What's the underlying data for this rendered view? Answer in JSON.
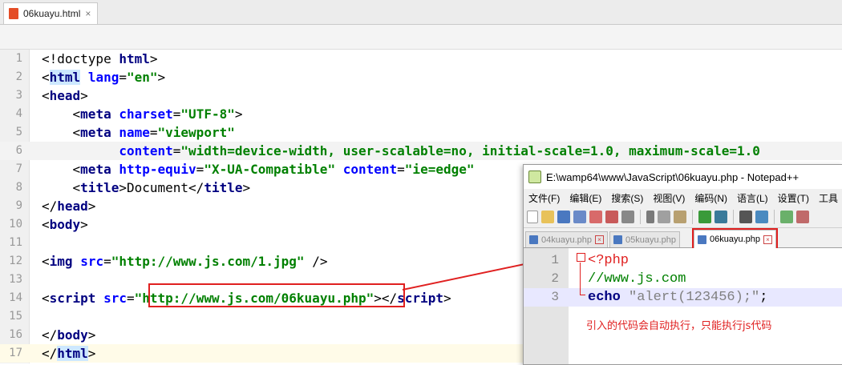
{
  "editor_tab": {
    "label": "06kuayu.html",
    "close": "×"
  },
  "lines": [
    {
      "n": "1",
      "parts": [
        [
          "p",
          "<!doctype "
        ],
        [
          "kw",
          "html"
        ],
        [
          "p",
          ">"
        ]
      ]
    },
    {
      "n": "2",
      "parts": [
        [
          "p",
          "<"
        ],
        [
          "hkw",
          "html"
        ],
        [
          "p",
          " "
        ],
        [
          "at",
          "lang"
        ],
        [
          "p",
          "="
        ],
        [
          "st",
          "\"en\""
        ],
        [
          "p",
          ">"
        ]
      ]
    },
    {
      "n": "3",
      "parts": [
        [
          "p",
          "<"
        ],
        [
          "kw",
          "head"
        ],
        [
          "p",
          ">"
        ]
      ]
    },
    {
      "n": "4",
      "parts": [
        [
          "p",
          "    <"
        ],
        [
          "kw",
          "meta"
        ],
        [
          "p",
          " "
        ],
        [
          "at",
          "charset"
        ],
        [
          "p",
          "="
        ],
        [
          "st",
          "\"UTF-8\""
        ],
        [
          "p",
          ">"
        ]
      ]
    },
    {
      "n": "5",
      "parts": [
        [
          "p",
          "    <"
        ],
        [
          "kw",
          "meta"
        ],
        [
          "p",
          " "
        ],
        [
          "at",
          "name"
        ],
        [
          "p",
          "="
        ],
        [
          "st",
          "\"viewport\""
        ]
      ]
    },
    {
      "n": "6",
      "parts": [
        [
          "p",
          "          "
        ],
        [
          "at",
          "content"
        ],
        [
          "p",
          "="
        ],
        [
          "st",
          "\"width=device-width, user-scalable=no, initial-scale=1.0, maximum-scale=1.0"
        ]
      ]
    },
    {
      "n": "7",
      "parts": [
        [
          "p",
          "    <"
        ],
        [
          "kw",
          "meta"
        ],
        [
          "p",
          " "
        ],
        [
          "at",
          "http-equiv"
        ],
        [
          "p",
          "="
        ],
        [
          "st",
          "\"X-UA-Compatible\""
        ],
        [
          "p",
          " "
        ],
        [
          "at",
          "content"
        ],
        [
          "p",
          "="
        ],
        [
          "st",
          "\"ie=edge\""
        ]
      ]
    },
    {
      "n": "8",
      "parts": [
        [
          "p",
          "    <"
        ],
        [
          "kw",
          "title"
        ],
        [
          "p",
          ">Document</"
        ],
        [
          "kw",
          "title"
        ],
        [
          "p",
          ">"
        ]
      ]
    },
    {
      "n": "9",
      "parts": [
        [
          "p",
          "</"
        ],
        [
          "kw",
          "head"
        ],
        [
          "p",
          ">"
        ]
      ]
    },
    {
      "n": "10",
      "parts": [
        [
          "p",
          "<"
        ],
        [
          "kw",
          "body"
        ],
        [
          "p",
          ">"
        ]
      ]
    },
    {
      "n": "11",
      "parts": []
    },
    {
      "n": "12",
      "parts": [
        [
          "p",
          "<"
        ],
        [
          "kw",
          "img"
        ],
        [
          "p",
          " "
        ],
        [
          "at",
          "src"
        ],
        [
          "p",
          "="
        ],
        [
          "st",
          "\"http://www.js.com/1.jpg\""
        ],
        [
          "p",
          " />"
        ]
      ]
    },
    {
      "n": "13",
      "parts": []
    },
    {
      "n": "14",
      "parts": [
        [
          "p",
          "<"
        ],
        [
          "kw",
          "script"
        ],
        [
          "p",
          " "
        ],
        [
          "at",
          "src"
        ],
        [
          "p",
          "="
        ],
        [
          "st",
          "\"http://www.js.com/06kuayu.php\""
        ],
        [
          "p",
          "></"
        ],
        [
          "kw",
          "script"
        ],
        [
          "p",
          ">"
        ]
      ]
    },
    {
      "n": "15",
      "parts": []
    },
    {
      "n": "16",
      "parts": [
        [
          "p",
          "</"
        ],
        [
          "kw",
          "body"
        ],
        [
          "p",
          ">"
        ]
      ]
    },
    {
      "n": "17",
      "parts": [
        [
          "p",
          "</"
        ],
        [
          "hkw",
          "html"
        ],
        [
          "p",
          ">"
        ]
      ]
    }
  ],
  "npp": {
    "title": "E:\\wamp64\\www\\JavaScript\\06kuayu.php - Notepad++",
    "menu": [
      "文件(F)",
      "编辑(E)",
      "搜索(S)",
      "视图(V)",
      "编码(N)",
      "语言(L)",
      "设置(T)",
      "工具"
    ],
    "tabs": [
      "04kuayu.php",
      "05kuayu.php",
      "06kuayu.php"
    ],
    "code_lines": [
      {
        "n": "1",
        "parts": [
          [
            "php",
            "<?php"
          ]
        ]
      },
      {
        "n": "2",
        "parts": [
          [
            "cmt",
            "//www.js.com"
          ]
        ]
      },
      {
        "n": "3",
        "parts": [
          [
            "ech",
            "echo"
          ],
          [
            "p",
            " "
          ],
          [
            "str",
            "\"alert(123456);\""
          ],
          [
            "p",
            ";"
          ]
        ]
      }
    ],
    "annotation": "引入的代码会自动执行，只能执行js代码"
  },
  "colors": {
    "annotation_red": "#e02020",
    "keyword": "#000080",
    "attribute": "#0000ff",
    "string": "#008000"
  }
}
